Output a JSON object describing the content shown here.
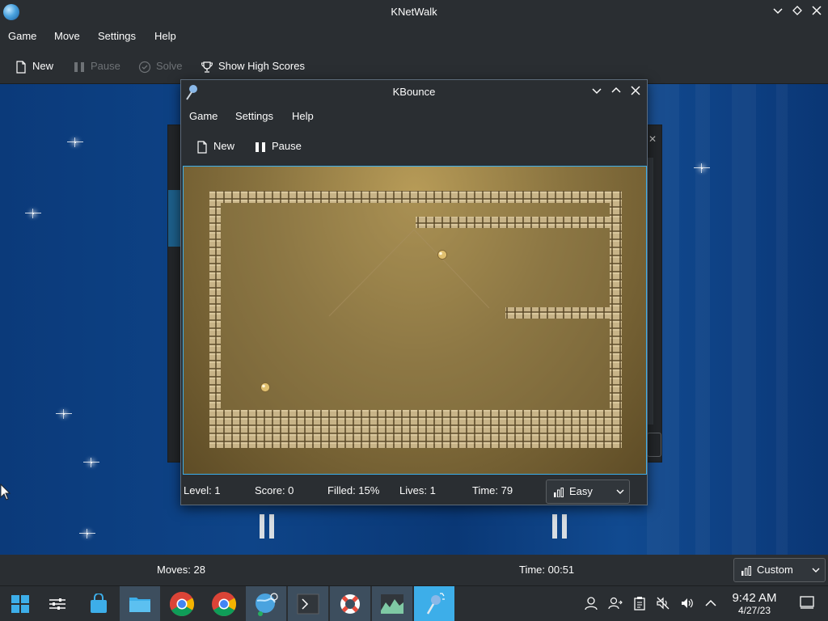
{
  "knetwalk": {
    "title": "KNetWalk",
    "menu": [
      "Game",
      "Move",
      "Settings",
      "Help"
    ],
    "toolbar": {
      "new_label": "New",
      "pause_label": "Pause",
      "solve_label": "Solve",
      "highscores_label": "Show High Scores"
    },
    "status": {
      "moves": "Moves: 28",
      "time": "Time: 00:51",
      "difficulty": "Custom"
    }
  },
  "kbounce": {
    "title": "KBounce",
    "menu": [
      "Game",
      "Settings",
      "Help"
    ],
    "toolbar": {
      "new_label": "New",
      "pause_label": "Pause"
    },
    "status": {
      "level": "Level: 1",
      "score": "Score: 0",
      "filled": "Filled: 15%",
      "lives": "Lives: 1",
      "time": "Time: 79",
      "difficulty": "Easy"
    },
    "filled_percent": 15
  },
  "taskbar": {
    "apps": [
      "start-menu",
      "system-settings",
      "discover",
      "file-manager",
      "chrome",
      "chrome",
      "knetwalk",
      "konsole",
      "help-center",
      "ksysguard",
      "kbounce"
    ],
    "clock_time": "9:42 AM",
    "clock_date": "4/27/23"
  },
  "colors": {
    "accent": "#3daee9",
    "window_bg": "#2a2e32",
    "board_blue": "#0e4488",
    "wall_tile": "#c8b488"
  }
}
